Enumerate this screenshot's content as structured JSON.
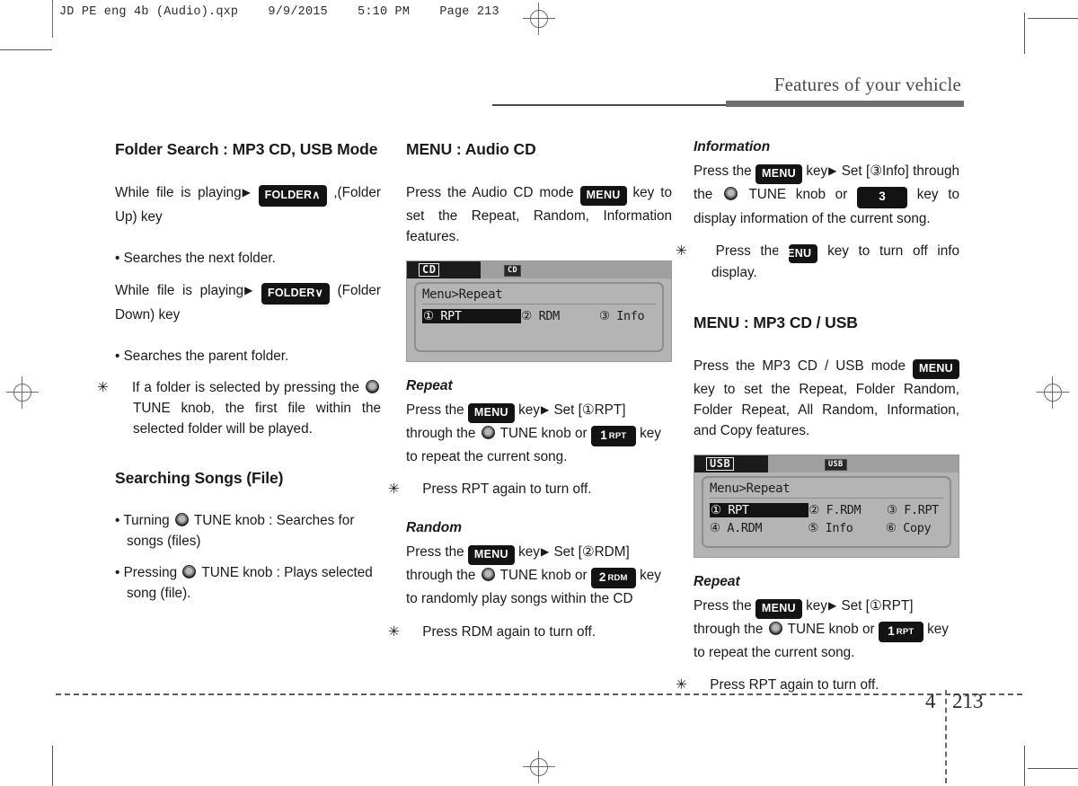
{
  "prepress": {
    "header": "JD PE eng 4b (Audio).qxp    9/9/2015    5:10 PM    Page 213"
  },
  "running_head": {
    "title": "Features of your vehicle"
  },
  "footer": {
    "chapter": "4",
    "page": "213"
  },
  "column1": {
    "heading": "Folder Search : MP3 CD, USB Mode",
    "line1_pre": "While file is playing",
    "line1_key": "FOLDER∧",
    "line1_post": ",(Folder Up) key",
    "bullet1": "• Searches the next folder.",
    "line2_pre": "While file is playing",
    "line2_key": "FOLDER∨",
    "line2_post": "(Folder Down) key",
    "bullet2": "• Searches the parent folder.",
    "note1_mark": "✳",
    "note1_a": "If a folder is selected by pressing the",
    "note1_b": "TUNE knob, the first file within the selected folder will be played.",
    "heading2": "Searching Songs (File)",
    "bullet3_a": "• Turning",
    "bullet3_b": "TUNE knob : Searches for songs (files)",
    "bullet4_a": "• Pressing",
    "bullet4_b": "TUNE knob : Plays selected song (file)."
  },
  "column2": {
    "heading": "MENU : Audio CD",
    "intro_a": "Press the Audio CD mode",
    "intro_key": "MENU",
    "intro_b": "key to set the Repeat, Random, Information features.",
    "lcd": {
      "tab_label": "CD",
      "chip_label": "CD",
      "title": "Menu>Repeat",
      "items": [
        {
          "label": "① RPT",
          "highlight": true
        },
        {
          "label": "② RDM",
          "highlight": false
        },
        {
          "label": "③ Info",
          "highlight": false
        }
      ]
    },
    "repeat": {
      "title": "Repeat",
      "a": "Press the",
      "key_menu": "MENU",
      "b": "key",
      "arrow": "▶",
      "c": "Set [①RPT] through the",
      "d": "TUNE knob or",
      "key_num": "1",
      "key_num_sub": "RPT",
      "e": "key to repeat the current song.",
      "note_mark": "✳",
      "note": "Press RPT again to turn off."
    },
    "random": {
      "title": "Random",
      "a": "Press the",
      "key_menu": "MENU",
      "b": "key",
      "arrow": "▶",
      "c": "Set [②RDM] through the",
      "d": "TUNE knob or",
      "key_num": "2",
      "key_num_sub": "RDM",
      "e": "key to randomly play songs within the CD",
      "note_mark": "✳",
      "note": "Press RDM again to turn off."
    }
  },
  "column3": {
    "information": {
      "title": "Information",
      "a": "Press the",
      "key_menu": "MENU",
      "b": "key",
      "arrow": "▶",
      "c": "Set [③Info] through the",
      "d": "TUNE knob or",
      "key_num": "3",
      "e": "key to display information of the current song.",
      "note_mark": "✳",
      "note_a": "Press the",
      "note_key": "MENU",
      "note_b": "key to turn off info display."
    },
    "heading": "MENU : MP3 CD / USB",
    "intro_a": "Press the MP3 CD / USB mode",
    "intro_key": "MENU",
    "intro_b": "key to set the Repeat, Folder Random, Folder Repeat, All Random, Information, and Copy features.",
    "lcd": {
      "tab_label": "USB",
      "chip_label": "USB",
      "title": "Menu>Repeat",
      "row1": [
        {
          "label": "① RPT",
          "highlight": true
        },
        {
          "label": "② F.RDM",
          "highlight": false
        },
        {
          "label": "③ F.RPT",
          "highlight": false
        }
      ],
      "row2": [
        {
          "label": "④ A.RDM",
          "highlight": false
        },
        {
          "label": "⑤ Info",
          "highlight": false
        },
        {
          "label": "⑥ Copy",
          "highlight": false
        }
      ]
    },
    "repeat": {
      "title": "Repeat",
      "a": "Press the",
      "key_menu": "MENU",
      "b": "key",
      "arrow": "▶",
      "c": "Set [①RPT] through the",
      "d": "TUNE knob or",
      "key_num": "1",
      "key_num_sub": "RPT",
      "e": "key to repeat the current song.",
      "note_mark": "✳",
      "note": "Press RPT again to turn off."
    }
  },
  "colors": {
    "key_background": "#131313",
    "lcd_background": "#b4b4b4",
    "runhead_bar": "#6e6e6e"
  }
}
